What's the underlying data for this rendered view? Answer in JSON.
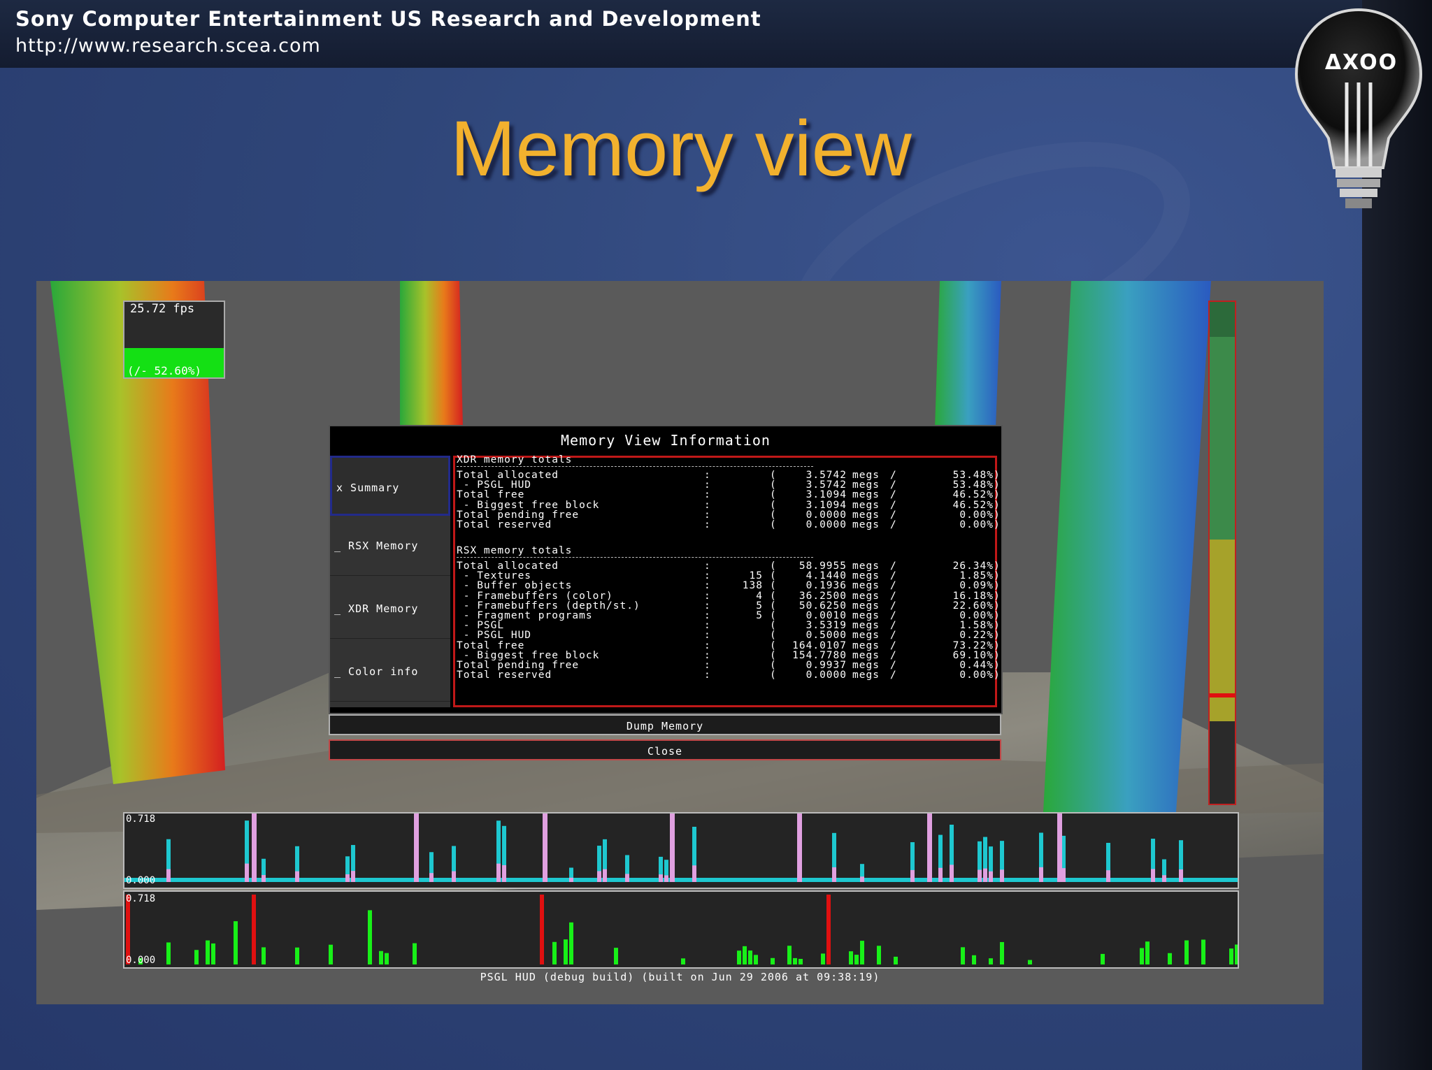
{
  "header": {
    "title": "Sony Computer Entertainment US Research and Development",
    "url": "http://www.research.scea.com"
  },
  "logo": {
    "text": "ΔXOO",
    "icon": "lightbulb-icon"
  },
  "slide": {
    "title": "Memory view"
  },
  "hud": {
    "fps": "25.72 fps",
    "fps_pct": "(/- 52.60%)",
    "dialog": {
      "title": "Memory View Information",
      "tabs": [
        {
          "label": "x Summary",
          "selected": true
        },
        {
          "label": "_ RSX Memory",
          "selected": false
        },
        {
          "label": "_ XDR Memory",
          "selected": false
        },
        {
          "label": "_ Color info",
          "selected": false
        }
      ],
      "xdr_title": "XDR memory totals",
      "xdr_rows": [
        {
          "label": "Total allocated",
          "count": "",
          "megs": "3.5742",
          "pct": "53.48%"
        },
        {
          "label": " - PSGL HUD",
          "count": "",
          "megs": "3.5742",
          "pct": "53.48%"
        },
        {
          "label": "Total free",
          "count": "",
          "megs": "3.1094",
          "pct": "46.52%"
        },
        {
          "label": " - Biggest free block",
          "count": "",
          "megs": "3.1094",
          "pct": "46.52%"
        },
        {
          "label": "Total pending free",
          "count": "",
          "megs": "0.0000",
          "pct": "0.00%"
        },
        {
          "label": "Total reserved",
          "count": "",
          "megs": "0.0000",
          "pct": "0.00%"
        }
      ],
      "rsx_title": "RSX memory totals",
      "rsx_rows": [
        {
          "label": "Total allocated",
          "count": "",
          "megs": "58.9955",
          "pct": "26.34%"
        },
        {
          "label": " - Textures",
          "count": "15",
          "megs": "4.1440",
          "pct": "1.85%"
        },
        {
          "label": " - Buffer objects",
          "count": "138",
          "megs": "0.1936",
          "pct": "0.09%"
        },
        {
          "label": " - Framebuffers (color)",
          "count": "4",
          "megs": "36.2500",
          "pct": "16.18%"
        },
        {
          "label": " - Framebuffers (depth/st.)",
          "count": "5",
          "megs": "50.6250",
          "pct": "22.60%"
        },
        {
          "label": " - Fragment programs",
          "count": "5",
          "megs": "0.0010",
          "pct": "0.00%"
        },
        {
          "label": " - PSGL",
          "count": "",
          "megs": "3.5319",
          "pct": "1.58%"
        },
        {
          "label": " - PSGL HUD",
          "count": "",
          "megs": "0.5000",
          "pct": "0.22%"
        },
        {
          "label": "Total free",
          "count": "",
          "megs": "164.0107",
          "pct": "73.22%"
        },
        {
          "label": " - Biggest free block",
          "count": "",
          "megs": "154.7780",
          "pct": "69.10%"
        },
        {
          "label": "Total pending free",
          "count": "",
          "megs": "0.9937",
          "pct": "0.44%"
        },
        {
          "label": "Total reserved",
          "count": "",
          "megs": "0.0000",
          "pct": "0.00%"
        }
      ],
      "separator": ":",
      "open_paren": "(",
      "unit": "megs",
      "slash": "/",
      "close_paren": ")",
      "dump_button": "Dump Memory",
      "close_button": "Close"
    },
    "graph_top": {
      "max_label": "0.718",
      "min_label": "0.000"
    },
    "graph_bottom": {
      "max_label": "0.718",
      "min_label": "0.000"
    },
    "footer": "PSGL HUD (debug build) (built on Jun 29 2006 at 09:38:19)"
  }
}
